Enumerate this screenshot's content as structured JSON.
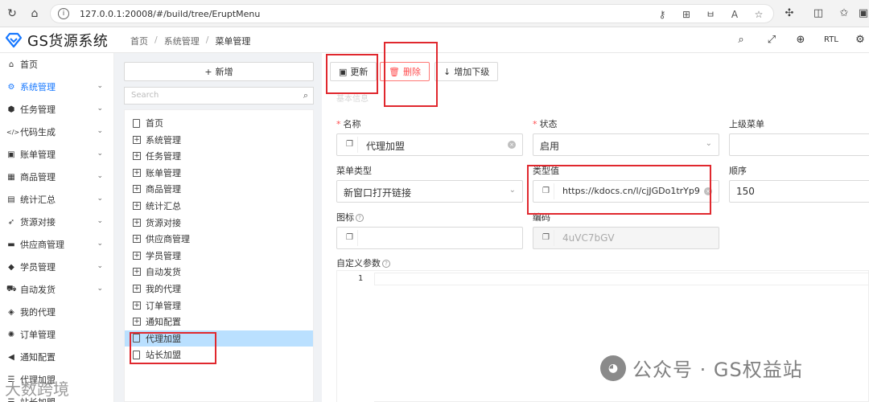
{
  "browser": {
    "url": "127.0.0.1:20008/#/build/tree/EruptMenu",
    "reader_label": "RTL"
  },
  "app": {
    "logo_text": "GS货源系统",
    "breadcrumb": [
      "首页",
      "系统管理",
      "菜单管理"
    ],
    "rtl_label": "RTL"
  },
  "sidebar": {
    "items": [
      {
        "label": "首页",
        "icon": "home-icon"
      },
      {
        "label": "系统管理",
        "icon": "cogs-icon",
        "active": true
      },
      {
        "label": "任务管理",
        "icon": "cubes-icon"
      },
      {
        "label": "代码生成",
        "icon": "code-icon"
      },
      {
        "label": "账单管理",
        "icon": "money-icon"
      },
      {
        "label": "商品管理",
        "icon": "calendar-icon"
      },
      {
        "label": "统计汇总",
        "icon": "table-icon"
      },
      {
        "label": "货源对接",
        "icon": "rocket-icon"
      },
      {
        "label": "供应商管理",
        "icon": "archive-icon"
      },
      {
        "label": "学员管理",
        "icon": "graduation-icon"
      },
      {
        "label": "自动发货",
        "icon": "car-icon"
      },
      {
        "label": "我的代理",
        "icon": "tag-icon"
      },
      {
        "label": "订单管理",
        "icon": "gear-icon"
      },
      {
        "label": "通知配置",
        "icon": "bullhorn-icon"
      },
      {
        "label": "代理加盟",
        "icon": "list-icon"
      },
      {
        "label": "站长加盟",
        "icon": "list-icon"
      }
    ]
  },
  "tree": {
    "add_label": "新增",
    "search_placeholder": "Search",
    "nodes": [
      {
        "label": "首页",
        "type": "file"
      },
      {
        "label": "系统管理",
        "type": "folder"
      },
      {
        "label": "任务管理",
        "type": "folder"
      },
      {
        "label": "账单管理",
        "type": "folder"
      },
      {
        "label": "商品管理",
        "type": "folder"
      },
      {
        "label": "统计汇总",
        "type": "folder"
      },
      {
        "label": "货源对接",
        "type": "folder"
      },
      {
        "label": "供应商管理",
        "type": "folder"
      },
      {
        "label": "学员管理",
        "type": "folder"
      },
      {
        "label": "自动发货",
        "type": "folder"
      },
      {
        "label": "我的代理",
        "type": "folder"
      },
      {
        "label": "订单管理",
        "type": "folder"
      },
      {
        "label": "通知配置",
        "type": "folder"
      },
      {
        "label": "代理加盟",
        "type": "file",
        "selected": true
      },
      {
        "label": "站长加盟",
        "type": "file"
      }
    ]
  },
  "toolbar": {
    "update_label": "更新",
    "delete_label": "删除",
    "add_child_label": "增加下级"
  },
  "form": {
    "section_label": "基本信息",
    "name_label": "名称",
    "name_value": "代理加盟",
    "status_label": "状态",
    "status_value": "启用",
    "parent_label": "上级菜单",
    "parent_value": "",
    "menu_type_label": "菜单类型",
    "menu_type_value": "新窗口打开链接",
    "type_value_label": "类型值",
    "type_value": "https://kdocs.cn/l/cjJGDo1trYp9",
    "order_label": "顺序",
    "order_value": "150",
    "icon_label": "图标",
    "icon_value": "",
    "code_label": "编码",
    "code_value": "4uVC7bGV",
    "params_label": "自定义参数",
    "editor_line_number": "1"
  },
  "watermark": {
    "text": "公众号 · GS权益站",
    "corner_text": "大数跨境"
  },
  "colors": {
    "accent": "#1677ff",
    "danger": "#ff4d4f",
    "highlight": "#e0282e",
    "selected_bg": "#bae0ff"
  }
}
